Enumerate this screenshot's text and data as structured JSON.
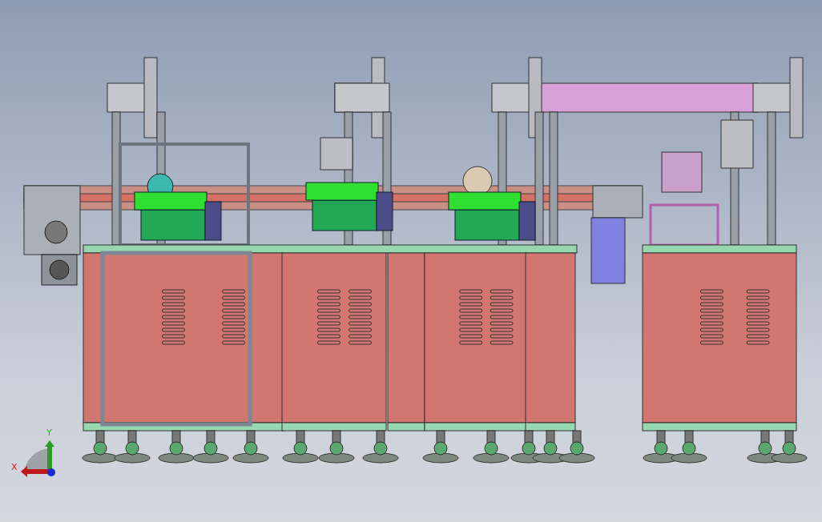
{
  "viewport": {
    "triad": {
      "x_label": "X",
      "y_label": "Y"
    }
  }
}
